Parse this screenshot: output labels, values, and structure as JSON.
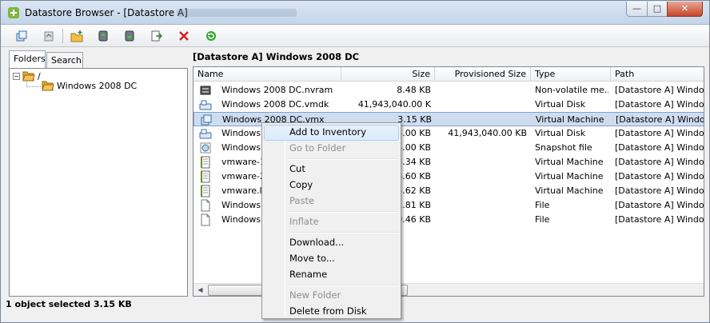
{
  "window": {
    "title": "Datastore Browser - [Datastore A]",
    "minimize": "—",
    "maximize": "□",
    "close": "✕"
  },
  "toolbar": [
    "browse-datastore-icon",
    "browse-parent-icon",
    "new-folder-icon",
    "upload-icon",
    "download-icon",
    "move-to-icon",
    "delete-icon",
    "refresh-icon"
  ],
  "tabs": {
    "folders": "Folders",
    "search": "Search"
  },
  "tree": {
    "root": "/",
    "child": "Windows 2008 DC"
  },
  "path_label": "[Datastore A] Windows 2008 DC",
  "columns": {
    "name": "Name",
    "size": "Size",
    "prov": "Provisioned Size",
    "type": "Type",
    "path": "Path"
  },
  "rows": [
    {
      "icon": "nvram-file-icon",
      "name": "Windows 2008 DC.nvram",
      "size": "8.48 KB",
      "prov": "",
      "type": "Non-volatile me...",
      "path": "[Datastore A] Window"
    },
    {
      "icon": "virtual-disk-icon",
      "name": "Windows 2008 DC.vmdk",
      "size": "41,943,040.00 K",
      "prov": "",
      "type": "Virtual Disk",
      "path": "[Datastore A] Window"
    },
    {
      "icon": "virtual-machine-icon",
      "name": "Windows 2008 DC.vmx",
      "size": "3.15 KB",
      "prov": "",
      "type": "Virtual Machine",
      "path": "[Datastore A] Window",
      "selected": true
    },
    {
      "icon": "virtual-disk-icon",
      "name": "Windows",
      "size": "4.00 KB",
      "prov": "41,943,040.00 KB",
      "type": "Virtual Disk",
      "path": "[Datastore A] Window"
    },
    {
      "icon": "snapshot-icon",
      "name": "Windows",
      "size": "4.00 KB",
      "prov": "",
      "type": "Snapshot file",
      "path": "[Datastore A] Window"
    },
    {
      "icon": "log-file-icon",
      "name": "vmware-1",
      "size": "3.34 KB",
      "prov": "",
      "type": "Virtual Machine",
      "path": "[Datastore A] Window"
    },
    {
      "icon": "log-file-icon",
      "name": "vmware-2",
      "size": "8.60 KB",
      "prov": "",
      "type": "Virtual Machine",
      "path": "[Datastore A] Window"
    },
    {
      "icon": "log-file-icon",
      "name": "vmware.lo",
      "size": "5.62 KB",
      "prov": "",
      "type": "Virtual Machine",
      "path": "[Datastore A] Window"
    },
    {
      "icon": "file-icon",
      "name": "Windows",
      "size": "1.81 KB",
      "prov": "",
      "type": "File",
      "path": "[Datastore A] Window"
    },
    {
      "icon": "file-icon",
      "name": "Windows",
      "size": "0.46 KB",
      "prov": "",
      "type": "File",
      "path": "[Datastore A] Window"
    }
  ],
  "status": "1 object selected 3.15 KB",
  "context_menu": [
    {
      "label": "Add to Inventory",
      "enabled": true,
      "highlighted": true
    },
    {
      "label": "Go to Folder",
      "enabled": false
    },
    {
      "sep": true
    },
    {
      "label": "Cut",
      "enabled": true
    },
    {
      "label": "Copy",
      "enabled": true
    },
    {
      "label": "Paste",
      "enabled": false
    },
    {
      "sep": true
    },
    {
      "label": "Inflate",
      "enabled": false
    },
    {
      "sep": true
    },
    {
      "label": "Download...",
      "enabled": true
    },
    {
      "label": "Move to...",
      "enabled": true
    },
    {
      "label": "Rename",
      "enabled": true
    },
    {
      "sep": true
    },
    {
      "label": "New Folder",
      "enabled": false
    },
    {
      "label": "Delete from Disk",
      "enabled": true
    }
  ],
  "colors": {
    "selection": "#cfdcf0",
    "folder": "#e8a53a",
    "delete": "#d62020",
    "refresh": "#2fa52f"
  }
}
